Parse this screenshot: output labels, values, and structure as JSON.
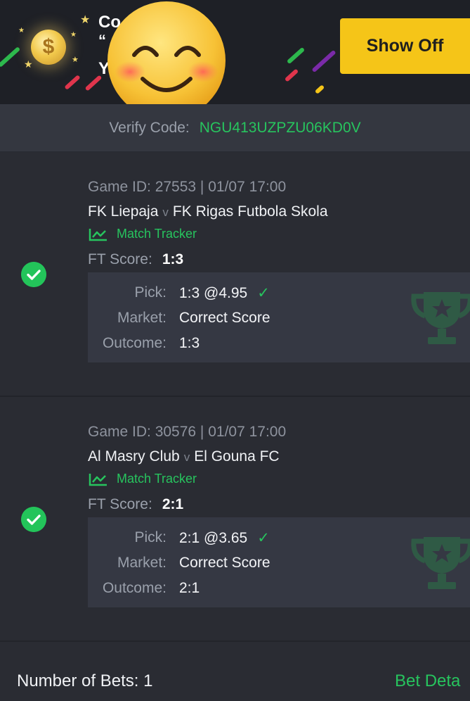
{
  "banner": {
    "line1": "Co          ons!",
    "line2": "“",
    "line3": "Y                ng!",
    "coin_icon": "dollar-coin-icon",
    "emoji_icon": "smiling-face-emoji",
    "show_off_label": "Show Off",
    "accent": "#f5c518"
  },
  "verify": {
    "label": "Verify Code:",
    "code": "NGU413UZPZU06KD0V"
  },
  "bets": [
    {
      "game_id": "Game ID: 27553 | 01/07 17:00",
      "home": "FK Liepaja",
      "vs": "v",
      "away": "FK Rigas Futbola Skola",
      "tracker": "Match Tracker",
      "ft_label": "FT Score:",
      "ft_value": "1:3",
      "pick_label": "Pick:",
      "pick_value": "1:3 @4.95",
      "market_label": "Market:",
      "market_value": "Correct Score",
      "outcome_label": "Outcome:",
      "outcome_value": "1:3",
      "status": "won"
    },
    {
      "game_id": "Game ID: 30576 | 01/07 17:00",
      "home": "Al Masry Club",
      "vs": "v",
      "away": "El Gouna FC",
      "tracker": "Match Tracker",
      "ft_label": "FT Score:",
      "ft_value": "2:1",
      "pick_label": "Pick:",
      "pick_value": "2:1 @3.65",
      "market_label": "Market:",
      "market_value": "Correct Score",
      "outcome_label": "Outcome:",
      "outcome_value": "2:1",
      "status": "won"
    }
  ],
  "footer": {
    "bets_count": "Number of Bets: 1",
    "bet_details": "Bet Deta"
  },
  "colors": {
    "green": "#27c45e",
    "background": "#2a2c33",
    "panel": "#353843"
  }
}
